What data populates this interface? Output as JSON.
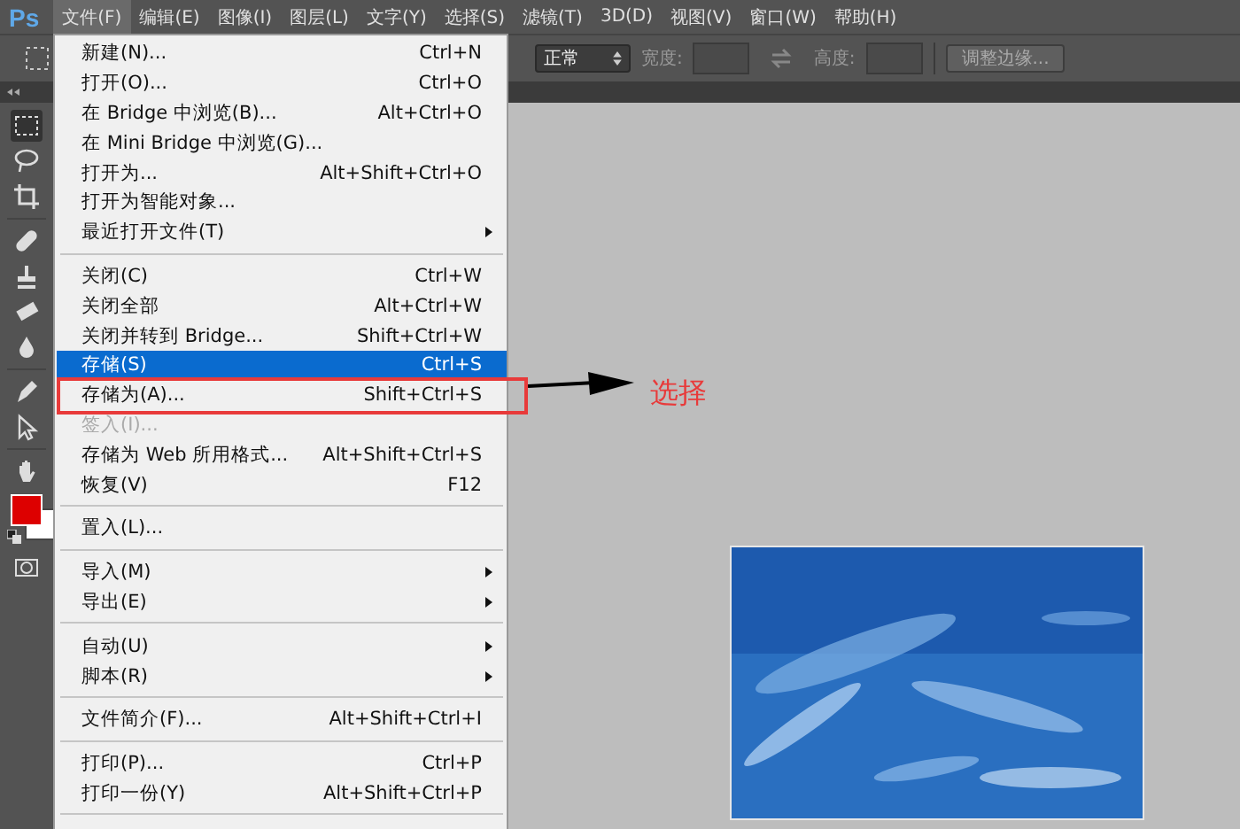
{
  "app": {
    "logo": "Ps"
  },
  "menu_bar": [
    {
      "label": "文件(F)",
      "selected": true
    },
    {
      "label": "编辑(E)",
      "selected": false
    },
    {
      "label": "图像(I)",
      "selected": false
    },
    {
      "label": "图层(L)",
      "selected": false
    },
    {
      "label": "文字(Y)",
      "selected": false
    },
    {
      "label": "选择(S)",
      "selected": false
    },
    {
      "label": "滤镜(T)",
      "selected": false
    },
    {
      "label": "3D(D)",
      "selected": false
    },
    {
      "label": "视图(V)",
      "selected": false
    },
    {
      "label": "窗口(W)",
      "selected": false
    },
    {
      "label": "帮助(H)",
      "selected": false
    }
  ],
  "options_bar": {
    "style_value": "正常",
    "width_label": "宽度:",
    "height_label": "高度:",
    "refine_button": "调整边缘..."
  },
  "file_menu": [
    {
      "kind": "item",
      "label": "新建(N)...",
      "shortcut": "Ctrl+N",
      "submenu": false,
      "selected": false,
      "disabled": false,
      "annotated": false
    },
    {
      "kind": "item",
      "label": "打开(O)...",
      "shortcut": "Ctrl+O",
      "submenu": false,
      "selected": false,
      "disabled": false,
      "annotated": false
    },
    {
      "kind": "item",
      "label": "在 Bridge 中浏览(B)...",
      "shortcut": "Alt+Ctrl+O",
      "submenu": false,
      "selected": false,
      "disabled": false,
      "annotated": false
    },
    {
      "kind": "item",
      "label": "在 Mini Bridge 中浏览(G)...",
      "submenu": false,
      "selected": false,
      "disabled": false,
      "annotated": false
    },
    {
      "kind": "item",
      "label": "打开为...",
      "shortcut": "Alt+Shift+Ctrl+O",
      "submenu": false,
      "selected": false,
      "disabled": false,
      "annotated": false
    },
    {
      "kind": "item",
      "label": "打开为智能对象...",
      "submenu": false,
      "selected": false,
      "disabled": false,
      "annotated": false
    },
    {
      "kind": "item",
      "label": "最近打开文件(T)",
      "submenu": true,
      "selected": false,
      "disabled": false,
      "annotated": false
    },
    {
      "kind": "separator"
    },
    {
      "kind": "item",
      "label": "关闭(C)",
      "shortcut": "Ctrl+W",
      "submenu": false,
      "selected": false,
      "disabled": false,
      "annotated": false
    },
    {
      "kind": "item",
      "label": "关闭全部",
      "shortcut": "Alt+Ctrl+W",
      "submenu": false,
      "selected": false,
      "disabled": false,
      "annotated": false
    },
    {
      "kind": "item",
      "label": "关闭并转到 Bridge...",
      "shortcut": "Shift+Ctrl+W",
      "submenu": false,
      "selected": false,
      "disabled": false,
      "annotated": false
    },
    {
      "kind": "item",
      "label": "存储(S)",
      "shortcut": "Ctrl+S",
      "submenu": false,
      "selected": true,
      "disabled": false,
      "annotated": false
    },
    {
      "kind": "item",
      "label": "存储为(A)...",
      "shortcut": "Shift+Ctrl+S",
      "submenu": false,
      "selected": false,
      "disabled": false,
      "annotated": true
    },
    {
      "kind": "item",
      "label": "签入(I)...",
      "submenu": false,
      "selected": false,
      "disabled": true,
      "annotated": false
    },
    {
      "kind": "item",
      "label": "存储为 Web 所用格式...",
      "shortcut": "Alt+Shift+Ctrl+S",
      "submenu": false,
      "selected": false,
      "disabled": false,
      "annotated": false
    },
    {
      "kind": "item",
      "label": "恢复(V)",
      "shortcut": "F12",
      "submenu": false,
      "selected": false,
      "disabled": false,
      "annotated": false
    },
    {
      "kind": "separator"
    },
    {
      "kind": "item",
      "label": "置入(L)...",
      "submenu": false,
      "selected": false,
      "disabled": false,
      "annotated": false
    },
    {
      "kind": "separator"
    },
    {
      "kind": "item",
      "label": "导入(M)",
      "submenu": true,
      "selected": false,
      "disabled": false,
      "annotated": false
    },
    {
      "kind": "item",
      "label": "导出(E)",
      "submenu": true,
      "selected": false,
      "disabled": false,
      "annotated": false
    },
    {
      "kind": "separator"
    },
    {
      "kind": "item",
      "label": "自动(U)",
      "submenu": true,
      "selected": false,
      "disabled": false,
      "annotated": false
    },
    {
      "kind": "item",
      "label": "脚本(R)",
      "submenu": true,
      "selected": false,
      "disabled": false,
      "annotated": false
    },
    {
      "kind": "separator"
    },
    {
      "kind": "item",
      "label": "文件简介(F)...",
      "shortcut": "Alt+Shift+Ctrl+I",
      "submenu": false,
      "selected": false,
      "disabled": false,
      "annotated": false
    },
    {
      "kind": "separator"
    },
    {
      "kind": "item",
      "label": "打印(P)...",
      "shortcut": "Ctrl+P",
      "submenu": false,
      "selected": false,
      "disabled": false,
      "annotated": false
    },
    {
      "kind": "item",
      "label": "打印一份(Y)",
      "shortcut": "Alt+Shift+Ctrl+P",
      "submenu": false,
      "selected": false,
      "disabled": false,
      "annotated": false
    },
    {
      "kind": "separator"
    }
  ],
  "annotation": {
    "label": "选择"
  }
}
